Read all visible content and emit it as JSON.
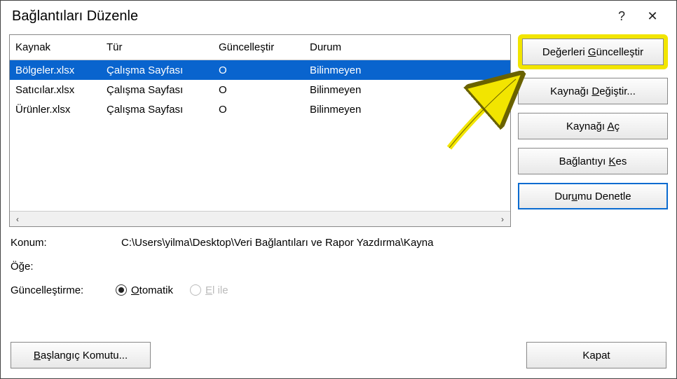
{
  "title": "Bağlantıları Düzenle",
  "help_char": "?",
  "close_char": "✕",
  "columns": {
    "source": "Kaynak",
    "type": "Tür",
    "update": "Güncelleştir",
    "status": "Durum"
  },
  "rows": [
    {
      "source": "Bölgeler.xlsx",
      "type": "Çalışma Sayfası",
      "update": "O",
      "status": "Bilinmeyen",
      "selected": true
    },
    {
      "source": "Satıcılar.xlsx",
      "type": "Çalışma Sayfası",
      "update": "O",
      "status": "Bilinmeyen",
      "selected": false
    },
    {
      "source": "Ürünler.xlsx",
      "type": "Çalışma Sayfası",
      "update": "O",
      "status": "Bilinmeyen",
      "selected": false
    }
  ],
  "buttons": {
    "update_values_pre": "Değerleri ",
    "update_values_u": "G",
    "update_values_post": "üncelleştir",
    "change_source_pre": "Kaynağı ",
    "change_source_u": "D",
    "change_source_post": "eğiştir...",
    "open_source_pre": "Kaynağı ",
    "open_source_u": "A",
    "open_source_post": "ç",
    "break_link_pre": "Bağlantıyı ",
    "break_link_u": "K",
    "break_link_post": "es",
    "check_status_pre": "Dur",
    "check_status_u": "u",
    "check_status_post": "mu Denetle",
    "startup_pre": "",
    "startup_u": "B",
    "startup_post": "aşlangıç Komutu...",
    "close": "Kapat"
  },
  "labels": {
    "location": "Konum:",
    "item": "Öğe:",
    "update": "Güncelleştirme:",
    "automatic_u": "O",
    "automatic_post": "tomatik",
    "manual_pre": "",
    "manual_u": "E",
    "manual_post": "l ile"
  },
  "location_path": "C:\\Users\\yilma\\Desktop\\Veri Bağlantıları ve Rapor Yazdırma\\Kayna",
  "scroll_left": "‹",
  "scroll_right": "›"
}
